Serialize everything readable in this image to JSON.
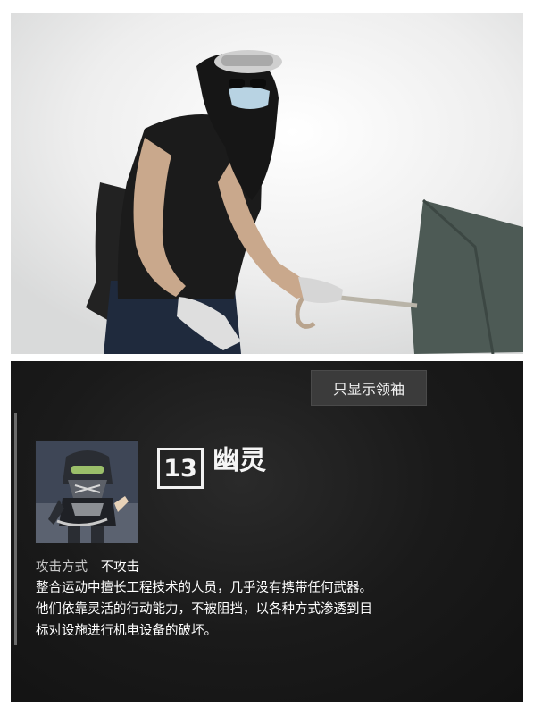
{
  "panel": {
    "leader_button_label": "只显示领袖",
    "unit": {
      "number": "13",
      "name": "幽灵",
      "avatar_icon": "ghost-unit-portrait"
    },
    "attack": {
      "label": "攻击方式",
      "value": "不攻击"
    },
    "description_lines": [
      "整合运动中擅长工程技术的人员，几乎没有携带任何武器。",
      "他们依靠灵活的行动能力，不被阻挡，以各种方式渗透到目",
      "标对设施进行机电设备的破坏。"
    ]
  },
  "colors": {
    "panel_bg": "#1a1a1a",
    "button_bg": "#3b3b3b",
    "text": "#ffffff"
  }
}
